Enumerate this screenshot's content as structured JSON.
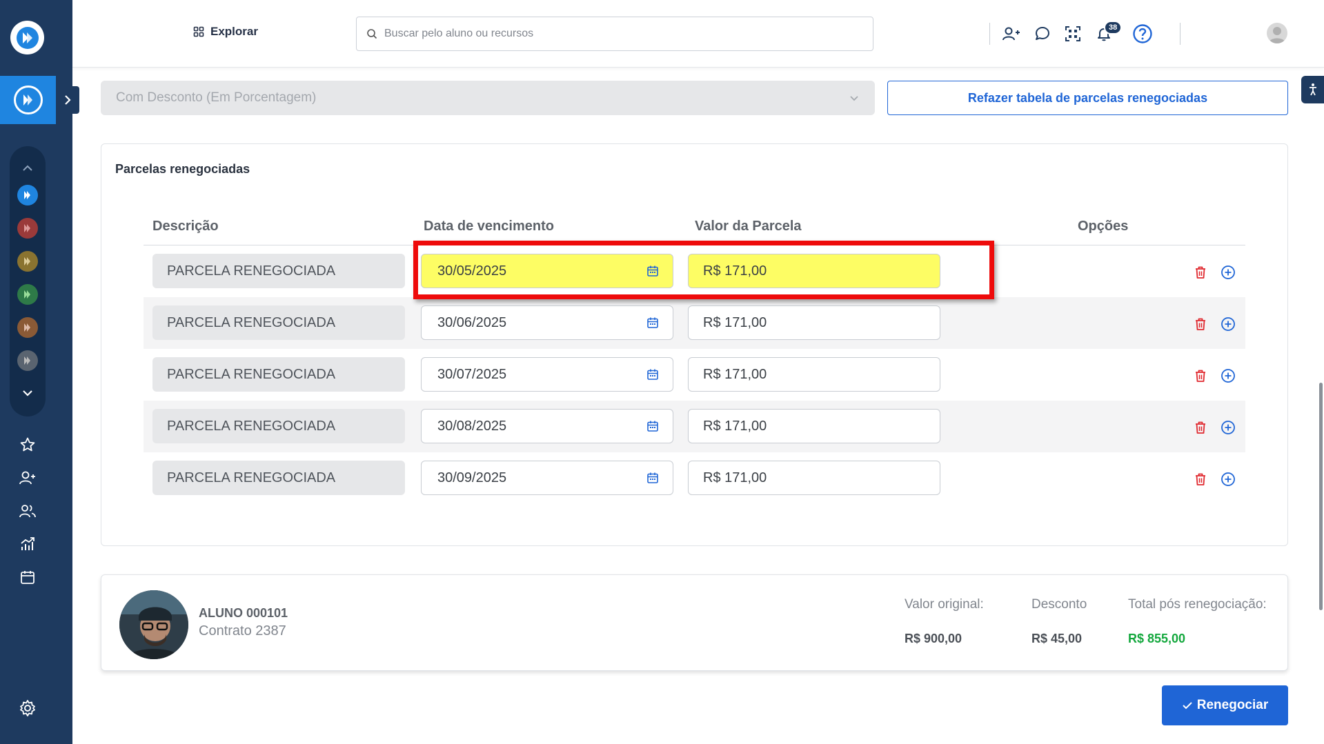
{
  "topbar": {
    "explore_label": "Explorar",
    "search_placeholder": "Buscar pelo aluno ou recursos",
    "notification_count": "38"
  },
  "discount": {
    "selected": "Com Desconto (Em Porcentagem)",
    "redo_label": "Refazer tabela de parcelas renegociadas"
  },
  "installments": {
    "title": "Parcelas renegociadas",
    "columns": [
      "Descrição",
      "Data de vencimento",
      "Valor da Parcela",
      "Opções"
    ],
    "rows": [
      {
        "description": "PARCELA RENEGOCIADA",
        "due_date": "30/05/2025",
        "amount": "R$ 171,00"
      },
      {
        "description": "PARCELA RENEGOCIADA",
        "due_date": "30/06/2025",
        "amount": "R$ 171,00"
      },
      {
        "description": "PARCELA RENEGOCIADA",
        "due_date": "30/07/2025",
        "amount": "R$ 171,00"
      },
      {
        "description": "PARCELA RENEGOCIADA",
        "due_date": "30/08/2025",
        "amount": "R$ 171,00"
      },
      {
        "description": "PARCELA RENEGOCIADA",
        "due_date": "30/09/2025",
        "amount": "R$ 171,00"
      }
    ]
  },
  "summary": {
    "student_name": "ALUNO 000101",
    "contract": "Contrato 2387",
    "original_label": "Valor original:",
    "original_value": "R$ 900,00",
    "discount_label": "Desconto",
    "discount_value": "R$ 45,00",
    "total_label": "Total pós renegociação:",
    "total_value": "R$ 855,00"
  },
  "actions": {
    "renegotiate_label": "Renegociar"
  },
  "colors": {
    "sidebar": "#1e3a5f",
    "primary": "#1f65d6",
    "highlight_fill": "#fdfd64",
    "highlight_border": "#ee0b0b",
    "total_green": "#12a73c",
    "danger": "#e0292f"
  }
}
